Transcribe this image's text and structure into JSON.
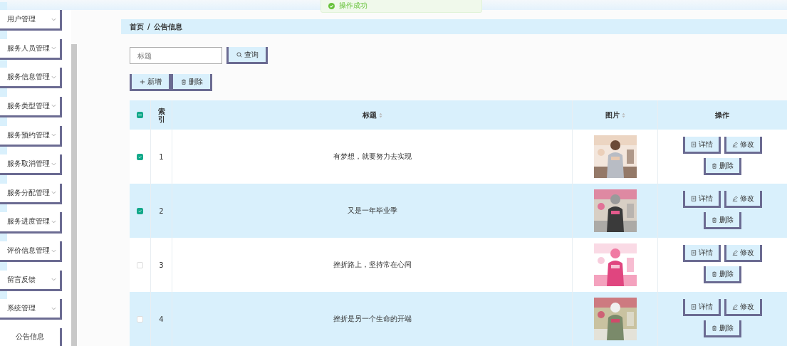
{
  "toast": {
    "text": "操作成功"
  },
  "sidebar": {
    "items": [
      {
        "label": "用户管理",
        "expanded": false
      },
      {
        "label": "服务人员管理",
        "expanded": false
      },
      {
        "label": "服务信息管理",
        "expanded": false
      },
      {
        "label": "服务类型管理",
        "expanded": false
      },
      {
        "label": "服务预约管理",
        "expanded": false
      },
      {
        "label": "服务取消管理",
        "expanded": false
      },
      {
        "label": "服务分配管理",
        "expanded": false
      },
      {
        "label": "服务进度管理",
        "expanded": false
      },
      {
        "label": "评价信息管理",
        "expanded": false
      },
      {
        "label": "留言反馈",
        "expanded": false
      },
      {
        "label": "系统管理",
        "expanded": true,
        "children": [
          {
            "label": "公告信息"
          }
        ]
      }
    ]
  },
  "breadcrumb": [
    "首页",
    "/",
    "公告信息"
  ],
  "search": {
    "placeholder": "标题",
    "button": "查询"
  },
  "toolbar": [
    "新增",
    "删除"
  ],
  "table": {
    "header_checkbox": {
      "indeterminate": true
    },
    "columns": [
      {
        "label": "索引",
        "sortable": false
      },
      {
        "label": "标题",
        "sortable": true
      },
      {
        "label": "图片",
        "sortable": true
      },
      {
        "label": "操作",
        "sortable": false
      }
    ],
    "rows": [
      {
        "selected": true,
        "index": "1",
        "title": "有梦想，就要努力去实现",
        "image": {
          "kind": "picture"
        },
        "actions": [
          "详情",
          "修改",
          "删除"
        ]
      },
      {
        "selected": true,
        "index": "2",
        "title": "又是一年毕业季",
        "image": {
          "kind": "picture"
        },
        "actions": [
          "详情",
          "修改",
          "删除"
        ]
      },
      {
        "selected": false,
        "index": "3",
        "title": "挫折路上，坚持常在心间",
        "image": {
          "kind": "picture"
        },
        "actions": [
          "详情",
          "修改",
          "删除"
        ]
      },
      {
        "selected": false,
        "index": "4",
        "title": "挫折是另一个生命的开端",
        "image": {
          "kind": "picture"
        },
        "actions": [
          "详情",
          "修改",
          "删除"
        ]
      }
    ]
  }
}
